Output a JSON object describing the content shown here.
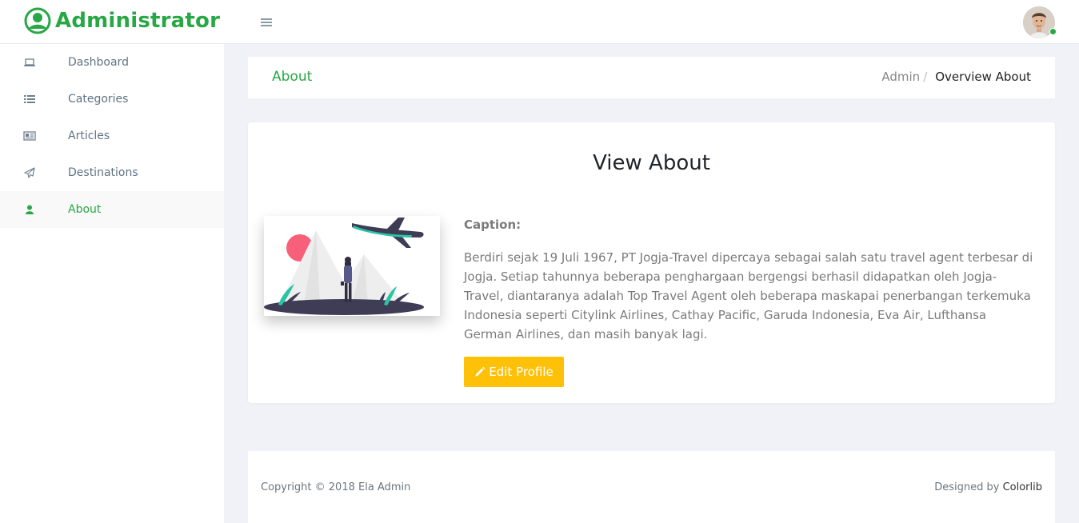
{
  "header": {
    "brand": "Administrator"
  },
  "sidebar": {
    "items": [
      {
        "label": "Dashboard",
        "icon": "laptop-icon",
        "active": false
      },
      {
        "label": "Categories",
        "icon": "list-icon",
        "active": false
      },
      {
        "label": "Articles",
        "icon": "newspaper-icon",
        "active": false
      },
      {
        "label": "Destinations",
        "icon": "paper-plane-icon",
        "active": false
      },
      {
        "label": "About",
        "icon": "user-icon",
        "active": true
      }
    ]
  },
  "breadcrumb": {
    "page_title": "About",
    "admin": "Admin",
    "separator": "/",
    "current": "Overview About"
  },
  "main": {
    "title": "View About",
    "caption_label": "Caption:",
    "caption_text": "Berdiri sejak 19 Juli 1967, PT Jogja-Travel dipercaya sebagai salah satu travel agent terbesar di Jogja. Setiap tahunnya beberapa penghargaan bergengsi berhasil didapatkan oleh Jogja-Travel, diantaranya adalah Top Travel Agent oleh beberapa maskapai penerbangan terkemuka Indonesia seperti Citylink Airlines, Cathay Pacific, Garuda Indonesia, Eva Air, Lufthansa German Airlines, dan masih banyak lagi.",
    "edit_button": "Edit Profile"
  },
  "footer": {
    "copyright": "Copyright © 2018 Ela Admin",
    "designed_by": "Designed by",
    "designer": "Colorlib"
  },
  "colors": {
    "accent": "#28a745",
    "button": "#ffc107",
    "background": "#f1f2f7"
  }
}
